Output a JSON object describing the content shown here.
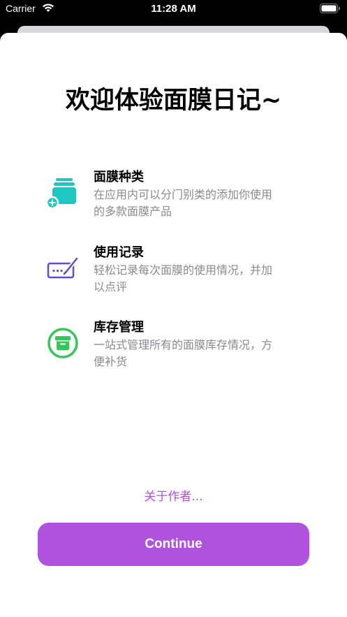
{
  "status_bar": {
    "carrier": "Carrier",
    "time": "11:28 AM"
  },
  "colors": {
    "accent": "#af52de",
    "teal": "#1fc6c2",
    "indigo": "#5b4fcf",
    "green": "#34c759",
    "secondary_text": "#8a8a8e"
  },
  "title": "欢迎体验面膜日记~",
  "features": [
    {
      "icon": "stack-add-icon",
      "title": "面膜种类",
      "description": "在应用内可以分门别类的添加你使用的多款面膜产品"
    },
    {
      "icon": "signature-icon",
      "title": "使用记录",
      "description": "轻松记录每次面膜的使用情况，并加以点评"
    },
    {
      "icon": "archivebox-icon",
      "title": "库存管理",
      "description": "一站式管理所有的面膜库存情况，方便补货"
    }
  ],
  "about_link": "关于作者...",
  "continue_label": "Continue"
}
